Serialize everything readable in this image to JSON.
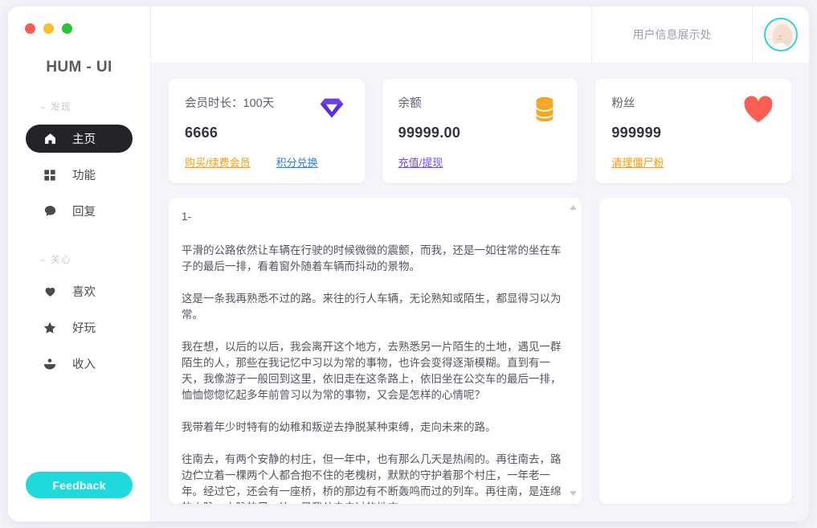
{
  "window": {
    "traffic_lights": [
      {
        "name": "close",
        "color": "#fb5b52"
      },
      {
        "name": "minimize",
        "color": "#fbbd2c"
      },
      {
        "name": "maximize",
        "color": "#24c633"
      }
    ]
  },
  "sidebar": {
    "brand": "HUM - UI",
    "sections": [
      {
        "dash": "–",
        "label": "发现",
        "items": [
          {
            "label": "主页",
            "icon": "home-icon",
            "active": true
          },
          {
            "label": "功能",
            "icon": "grid-icon",
            "active": false
          },
          {
            "label": "回复",
            "icon": "comment-icon",
            "active": false
          }
        ]
      },
      {
        "dash": "–",
        "label": "关心",
        "items": [
          {
            "label": "喜欢",
            "icon": "heart-icon",
            "active": false
          },
          {
            "label": "好玩",
            "icon": "star-icon",
            "active": false
          },
          {
            "label": "收入",
            "icon": "hand-holding-icon",
            "active": false
          }
        ]
      }
    ],
    "feedback_label": "Feedback",
    "feedback_color": "#1fd9dd"
  },
  "topbar": {
    "user_info_label": "用户信息展示处",
    "avatar_name": "user-avatar",
    "avatar_border_color": "#2ad6d8"
  },
  "stats": [
    {
      "title": "会员时长：100天",
      "value": "6666",
      "icon": "diamond-icon",
      "icon_color": "#6c3ef0",
      "links": [
        {
          "label": "购买/续费会员",
          "color": "#f59d0b"
        },
        {
          "label": "积分兑换",
          "color": "#2f7fe8"
        }
      ]
    },
    {
      "title": "余额",
      "value": "99999.00",
      "icon": "coins-icon",
      "icon_color": "#f5a623",
      "links": [
        {
          "label": "充值/提现",
          "color": "#7448f5"
        }
      ]
    },
    {
      "title": "粉丝",
      "value": "999999",
      "icon": "heart-filled-icon",
      "icon_color": "#fa5f52",
      "links": [
        {
          "label": "清理僵尸粉",
          "color": "#f59d0b"
        }
      ]
    }
  ],
  "article": {
    "paragraphs": [
      "1-",
      "平滑的公路依然让车辆在行驶的时候微微的震颤，而我，还是一如往常的坐在车子的最后一排，看着窗外随着车辆而抖动的景物。",
      "这是一条我再熟悉不过的路。来往的行人车辆，无论熟知或陌生，都显得习以为常。",
      "我在想，以后的以后，我会离开这个地方，去熟悉另一片陌生的土地，遇见一群陌生的人，那些在我记忆中习以为常的事物，也许会变得逐渐模糊。直到有一天，我像游子一般回到这里，依旧走在这条路上，依旧坐在公交车的最后一排，恤恤惚惚忆起多年前曾习以为常的事物，又会是怎样的心情呢？",
      "我带着年少时特有的幼稚和叛逆去挣脱某种束缚，走向未来的路。",
      "往南去，有两个安静的村庄，但一年中，也有那么几天是热闹的。再往南去，路边伫立着一棵两个人都合抱不住的老槐树，默默的守护着那个村庄，一年老一年。经过它，还会有一座桥，桥的那边有不断轰鸣而过的列车。再往南，是连绵的山脉，山脉的另一边，是我从未去过的地方。"
    ]
  },
  "side_panel": {
    "name": "empty-panel"
  }
}
